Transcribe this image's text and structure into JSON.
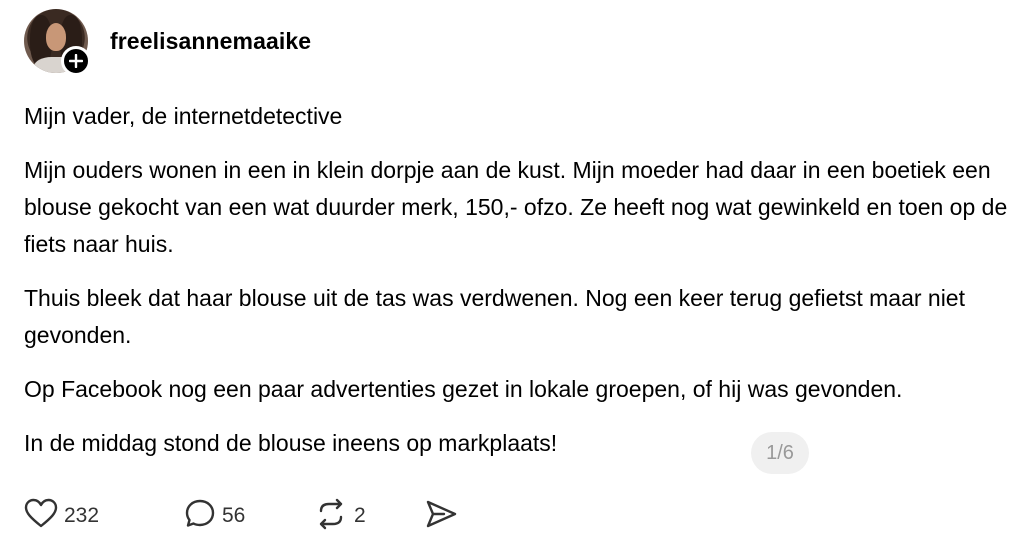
{
  "post": {
    "username": "freelisannemaaike",
    "title": "Mijn vader, de internetdetective",
    "paragraphs": [
      "Mijn ouders wonen in een in klein dorpje aan de kust. Mijn moeder had daar in een boetiek een blouse gekocht van een wat duurder merk, 150,- ofzo. Ze heeft nog wat gewinkeld en toen op de fiets naar huis.",
      "Thuis bleek dat haar blouse uit de tas was verdwenen. Nog een keer terug gefietst maar niet gevonden.",
      "Op Facebook nog een paar advertenties gezet in lokale groepen, of hij was gevonden.",
      "In de middag stond de blouse ineens op markplaats!"
    ],
    "pager": "1/6"
  },
  "actions": {
    "likes": "232",
    "replies": "56",
    "reposts": "2"
  },
  "icons": {
    "avatar_badge": "plus-icon",
    "like": "heart-icon",
    "reply": "speech-bubble-icon",
    "repost": "repost-icon",
    "share": "send-icon"
  }
}
